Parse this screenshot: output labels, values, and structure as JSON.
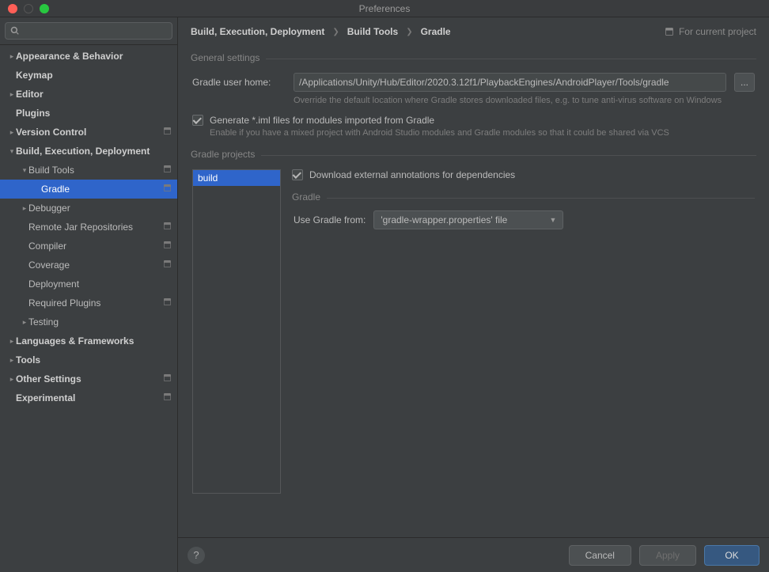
{
  "window": {
    "title": "Preferences"
  },
  "search": {
    "placeholder": ""
  },
  "tree": [
    {
      "label": "Appearance & Behavior",
      "depth": 0,
      "arrow": "right",
      "bold": true,
      "badge": false,
      "name": "tree-appearance-behavior"
    },
    {
      "label": "Keymap",
      "depth": 0,
      "arrow": "none",
      "bold": true,
      "badge": false,
      "name": "tree-keymap"
    },
    {
      "label": "Editor",
      "depth": 0,
      "arrow": "right",
      "bold": true,
      "badge": false,
      "name": "tree-editor"
    },
    {
      "label": "Plugins",
      "depth": 0,
      "arrow": "none",
      "bold": true,
      "badge": false,
      "name": "tree-plugins"
    },
    {
      "label": "Version Control",
      "depth": 0,
      "arrow": "right",
      "bold": true,
      "badge": true,
      "name": "tree-version-control"
    },
    {
      "label": "Build, Execution, Deployment",
      "depth": 0,
      "arrow": "down",
      "bold": true,
      "badge": false,
      "name": "tree-build-execution-deployment"
    },
    {
      "label": "Build Tools",
      "depth": 1,
      "arrow": "down",
      "bold": false,
      "badge": true,
      "name": "tree-build-tools"
    },
    {
      "label": "Gradle",
      "depth": 2,
      "arrow": "none",
      "bold": false,
      "badge": true,
      "selected": true,
      "name": "tree-gradle"
    },
    {
      "label": "Debugger",
      "depth": 1,
      "arrow": "right",
      "bold": false,
      "badge": false,
      "name": "tree-debugger"
    },
    {
      "label": "Remote Jar Repositories",
      "depth": 1,
      "arrow": "none",
      "bold": false,
      "badge": true,
      "name": "tree-remote-jar-repositories"
    },
    {
      "label": "Compiler",
      "depth": 1,
      "arrow": "none",
      "bold": false,
      "badge": true,
      "name": "tree-compiler"
    },
    {
      "label": "Coverage",
      "depth": 1,
      "arrow": "none",
      "bold": false,
      "badge": true,
      "name": "tree-coverage"
    },
    {
      "label": "Deployment",
      "depth": 1,
      "arrow": "none",
      "bold": false,
      "badge": false,
      "name": "tree-deployment"
    },
    {
      "label": "Required Plugins",
      "depth": 1,
      "arrow": "none",
      "bold": false,
      "badge": true,
      "name": "tree-required-plugins"
    },
    {
      "label": "Testing",
      "depth": 1,
      "arrow": "right",
      "bold": false,
      "badge": false,
      "name": "tree-testing"
    },
    {
      "label": "Languages & Frameworks",
      "depth": 0,
      "arrow": "right",
      "bold": true,
      "badge": false,
      "name": "tree-languages-frameworks"
    },
    {
      "label": "Tools",
      "depth": 0,
      "arrow": "right",
      "bold": true,
      "badge": false,
      "name": "tree-tools"
    },
    {
      "label": "Other Settings",
      "depth": 0,
      "arrow": "right",
      "bold": true,
      "badge": true,
      "name": "tree-other-settings"
    },
    {
      "label": "Experimental",
      "depth": 0,
      "arrow": "none",
      "bold": true,
      "badge": true,
      "name": "tree-experimental"
    }
  ],
  "breadcrumbs": {
    "a": "Build, Execution, Deployment",
    "b": "Build Tools",
    "c": "Gradle",
    "for_project": "For current project"
  },
  "general": {
    "heading": "General settings",
    "home_label": "Gradle user home:",
    "home_value": "/Applications/Unity/Hub/Editor/2020.3.12f1/PlaybackEngines/AndroidPlayer/Tools/gradle",
    "home_hint": "Override the default location where Gradle stores downloaded files, e.g. to tune anti-virus software on Windows",
    "more": "...",
    "iml_label": "Generate *.iml files for modules imported from Gradle",
    "iml_hint": "Enable if you have a mixed project with Android Studio modules and Gradle modules so that it could be shared via VCS"
  },
  "projects": {
    "heading": "Gradle projects",
    "items": [
      "build"
    ],
    "download_label": "Download external annotations for dependencies",
    "gradle_heading": "Gradle",
    "use_from_label": "Use Gradle from:",
    "use_from_value": "'gradle-wrapper.properties' file"
  },
  "buttons": {
    "cancel": "Cancel",
    "apply": "Apply",
    "ok": "OK",
    "help": "?"
  }
}
